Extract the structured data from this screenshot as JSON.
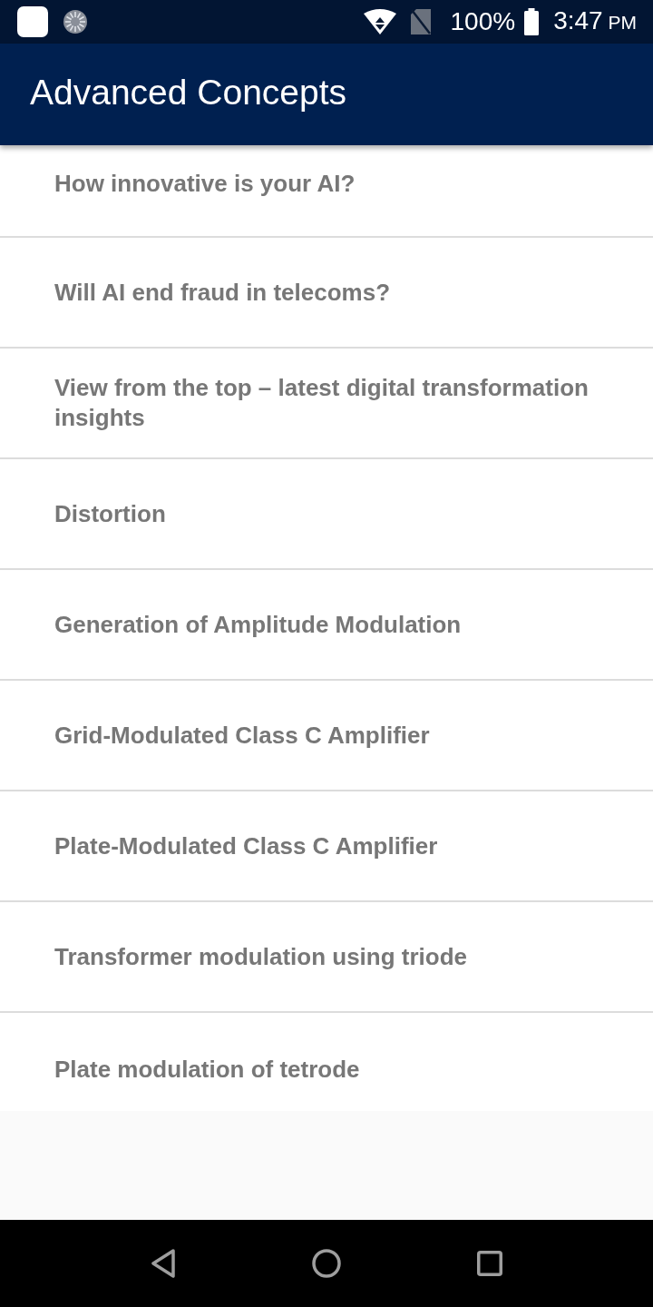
{
  "status_bar": {
    "battery": "100%",
    "time": "3:47",
    "time_suffix": "PM"
  },
  "app_bar": {
    "title": "Advanced Concepts"
  },
  "items": [
    {
      "title": "How innovative is your AI?"
    },
    {
      "title": "Will AI end fraud in telecoms?"
    },
    {
      "title": "View from the top – latest digital transformation insights"
    },
    {
      "title": "Distortion"
    },
    {
      "title": "Generation of Amplitude Modulation"
    },
    {
      "title": "Grid-Modulated Class C Amplifier"
    },
    {
      "title": "Plate-Modulated Class C Amplifier"
    },
    {
      "title": "Transformer modulation using triode"
    },
    {
      "title": "Plate modulation of tetrode"
    }
  ]
}
